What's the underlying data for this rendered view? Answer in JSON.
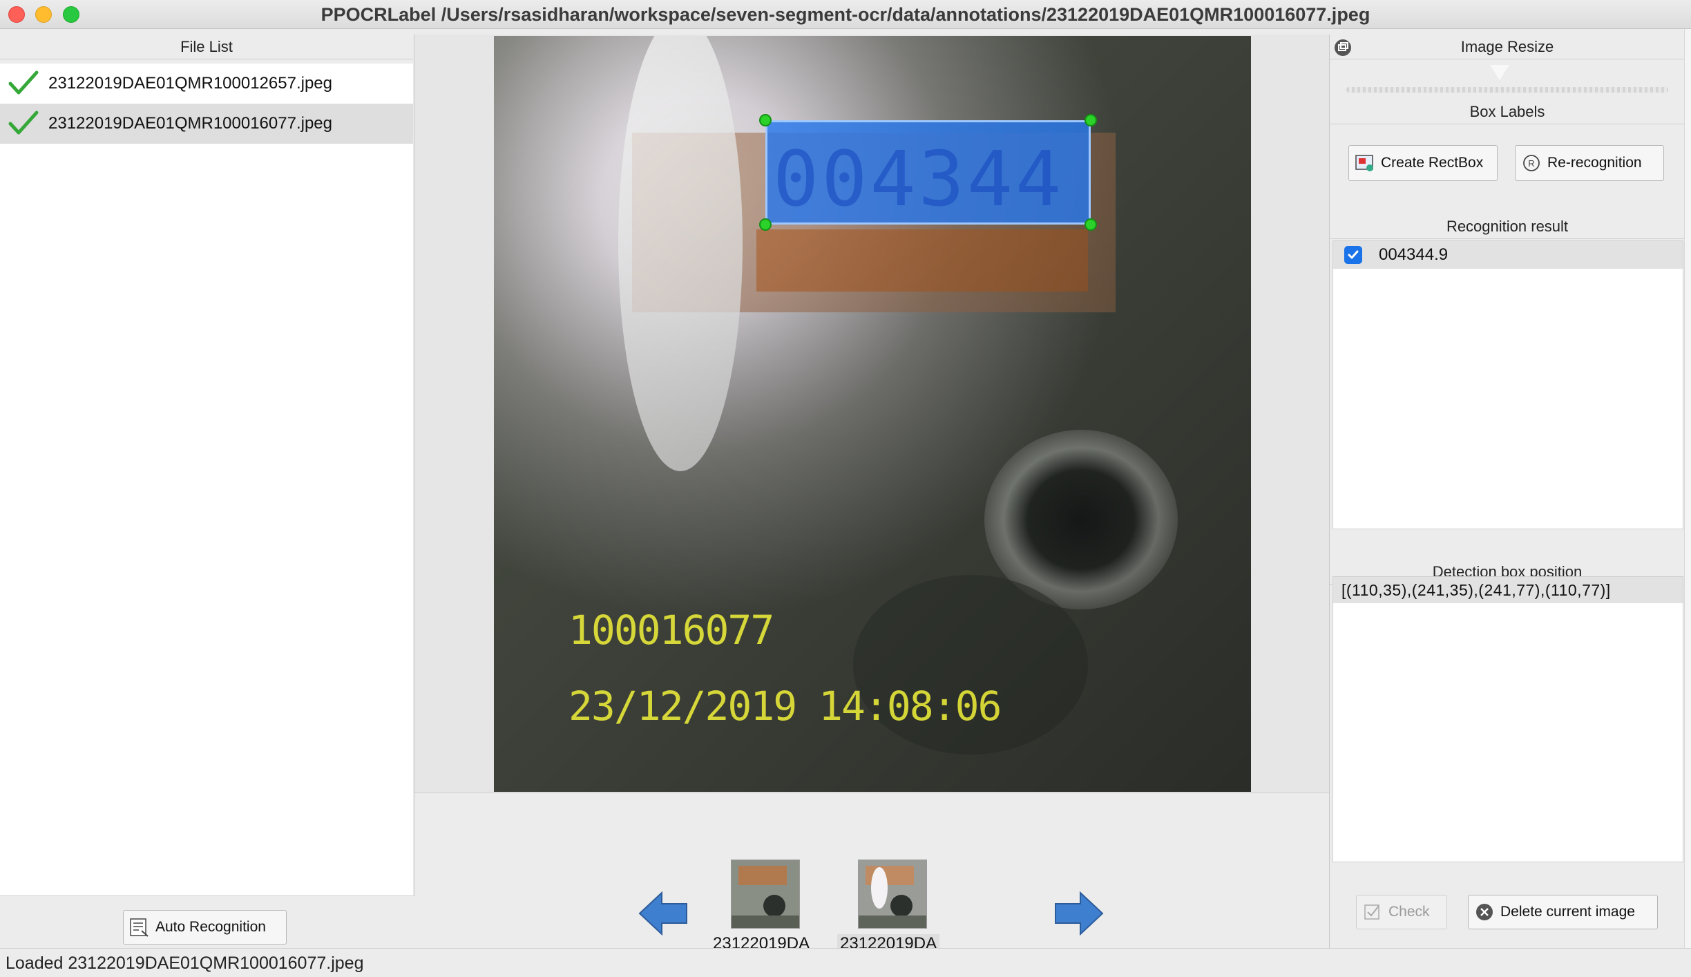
{
  "window": {
    "title": "PPOCRLabel /Users/rsasidharan/workspace/seven-segment-ocr/data/annotations/23122019DAE01QMR100016077.jpeg"
  },
  "file_list": {
    "header": "File List",
    "items": [
      {
        "name": "23122019DAE01QMR100012657.jpeg",
        "checked": true,
        "selected": false
      },
      {
        "name": "23122019DAE01QMR100016077.jpeg",
        "checked": true,
        "selected": true
      }
    ],
    "auto_recognition_label": "Auto Recognition"
  },
  "canvas": {
    "overlay_id_text": "100016077",
    "overlay_datetime_text": "23/12/2019 14:08:06",
    "box_color": "#2878eb",
    "handle_color": "#2ad22a"
  },
  "thumbnails": [
    {
      "label": "23122019DA",
      "selected": false
    },
    {
      "label": "23122019DA",
      "selected": true
    }
  ],
  "right_panel": {
    "image_resize_header": "Image Resize",
    "box_labels_header": "Box Labels",
    "create_rectbox_label": "Create RectBox",
    "re_recognition_label": "Re-recognition",
    "recognition_result_header": "Recognition result",
    "recognition_results": [
      {
        "text": "004344.9",
        "checked": true
      }
    ],
    "detection_box_header": "Detection box position",
    "detection_box_value": "[(110,35),(241,35),(241,77),(110,77)]",
    "check_label": "Check",
    "delete_image_label": "Delete current image"
  },
  "status": {
    "text": "Loaded 23122019DAE01QMR100016077.jpeg"
  },
  "icons": {
    "file_checked": "checkmark-icon",
    "prev": "left-arrow-icon",
    "next": "right-arrow-icon",
    "dock": "float-dock-icon"
  }
}
